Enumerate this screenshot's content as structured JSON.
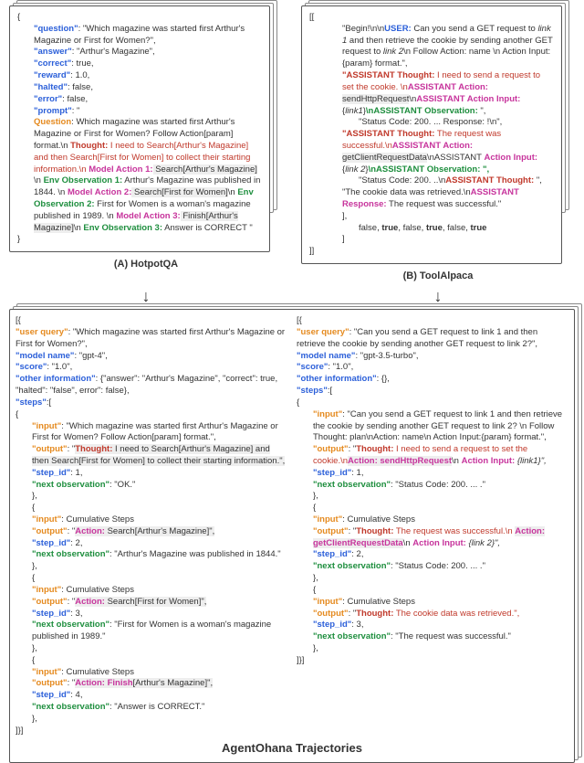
{
  "labels": {
    "a": "(A) HotpotQA",
    "b": "(B) ToolAlpaca",
    "bottom": "AgentOhana Trajectories",
    "arrow": "↓"
  },
  "boxA": {
    "open": "{",
    "q_key": "\"question\"",
    "q_val": ": \"Which magazine was started first Arthur's Magazine or First for Women?\",",
    "ans_key": "\"answer\"",
    "ans_val": ": \"Arthur's Magazine\",",
    "correct_key": "\"correct\"",
    "correct_val": ": true,",
    "reward_key": "\"reward\"",
    "reward_val": ": 1.0,",
    "halted_key": "\"halted\"",
    "halted_val": ": false,",
    "error_key": "\"error\"",
    "error_val": ": false,",
    "prompt_key": "\"prompt\"",
    "prompt_val": ": \"",
    "question_lbl": "Question",
    "question_txt": ": Which magazine was started first Arthur's Magazine or First for Women? Follow Action[param] format.\\n ",
    "thought_lbl": "Thought:",
    "thought_txt": " I need to Search[Arthur's Magazine] and then Search[First for Women] to collect their starting information.\\n ",
    "ma1_lbl": "Model Action 1:",
    "ma1_txt": " Search",
    "ma1_param": "[Arthur's Magazine]",
    "ma1_tail": " \\n ",
    "eo1_lbl": "Env Observation 1:",
    "eo1_txt": " Arthur's Magazine was published in 1844. \\n",
    "ma2_lbl": "Model Action 2:",
    "ma2_txt": " Search",
    "ma2_param": "[First for Women]",
    "ma2_tail": "\\n ",
    "eo2_lbl": "Env Observation 2:",
    "eo2_txt": " First for Women is a woman's magazine published in 1989. \\n ",
    "ma3_lbl": "Model Action 3:",
    "ma3_txt": " Finish",
    "ma3_param": "[Arthur's Magazine]",
    "ma3_tail": "\\n ",
    "eo3_lbl": "Env Observation 3:",
    "eo3_txt": " Answer is CORRECT \"",
    "close": "}"
  },
  "boxB": {
    "open": "[[",
    "begin": "\"Begin!\\n\\n",
    "user_lbl": "USER:",
    "user_txt": " Can you send a GET request to ",
    "link1": "link 1",
    "user_txt2": " and then retrieve the cookie by sending another GET request to ",
    "link2": "link 2",
    "user_txt3": "\\n Follow Action: name \\n Action Input:{param} format.\",",
    "at1_lbl": "\"ASSISTANT Thought:",
    "at1_txt": " I need to send a request to set the cookie. \\n",
    "aa_lbl": "ASSISTANT Action:",
    "aa_txt": " sendHttpRequest",
    "aa_tail": "\\n",
    "aai_lbl": "ASSISTANT Action Input:",
    "aai_txt": " {",
    "aai_link": "link1",
    "aai_tail": "}",
    "obs_lbl": "\\nASSISTANT Observation:",
    "obs_tail": " \",",
    "status1": "\"Status Code: 200. ... Response: !\\n\",",
    "at2_lbl": "\"ASSISTANT Thought:",
    "at2_txt": " The request was successful.\\n",
    "aa2_lbl": "ASSISTANT Action:",
    "aa2_txt": " getClientRequestData",
    "aa2_tail": "\\n",
    "aai2_lbl": "ASSISTANT ",
    "aai2_lbl2": "Action Input:",
    "aai2_txt": " {",
    "aai2_link": "link 2",
    "aai2_tail": "}",
    "obs2_tail": "\\nASSISTANT Observation: \",",
    "status2": "\"Status Code: 200. ..\\n",
    "at3_lbl": "ASSISTANT Thought:",
    "at3_txt": " \",",
    "cookie": "\"The cookie data was retrieved.\\n",
    "resp_lbl": "ASSISTANT Response:",
    "resp_txt": " The request was successful.\"",
    "close_arr": "],",
    "bools": "false, true, false, true, false, true",
    "close2": "]",
    "close3": "]]"
  },
  "botL": {
    "open": "[{",
    "uq_key": "\"user query\"",
    "uq_val": ": \"Which magazine was started first Arthur's Magazine or First for Women?\",",
    "mn_key": "\"model name\"",
    "mn_val": ": \"gpt-4\",",
    "score_key": "\"score\"",
    "score_val": ": \"1.0\",",
    "oi_key": "\"other information\"",
    "oi_val": ": {\"answer\": \"Arthur's Magazine\", \"correct\": true, \"halted\": \"false\", error\": false},",
    "steps_key": "\"steps\"",
    "steps_val": ":[",
    "s_open": "{",
    "in_key": "\"input\"",
    "s1_in": ": \"Which magazine was started first Arthur's Magazine or First for Women? Follow Action[param] format.\",",
    "out_key": "\"output\"",
    "s1_out_pre": ": \"",
    "s1_thought_lbl": "Thought:",
    "s1_thought_txt": " I need to Search[Arthur's Magazine] and then Search[First for Women] to collect their starting information.\",",
    "sid_key": "\"step_id\"",
    "s1_id": ": 1,",
    "no_key": "\"next observation\"",
    "s1_no": ": \"OK.\"",
    "s_close": "},",
    "cum": ": Cumulative Steps",
    "s2_out_pre": ": \"",
    "s2_act_lbl": "Action:",
    "s2_act_txt": " Search",
    "s2_act_param": "[Arthur's Magazine]\",",
    "s2_id": ": 2,",
    "s2_no": ": \"Arthur's Magazine was published in 1844.\"",
    "s3_act_param": "[First for Women]\",",
    "s3_id": ": 3,",
    "s3_no": ": \"First for Women is a woman's magazine published in 1989.\"",
    "s4_act_lbl": "Action: Finish",
    "s4_act_param": "[Arthur's Magazine]\",",
    "s4_id": ": 4,",
    "s4_no": ": \"Answer is CORRECT.\"",
    "close_steps": "},",
    "close_arr": "]}]"
  },
  "botR": {
    "open": "[{",
    "uq_key": "\"user query\"",
    "uq_val": ": \"Can you send a GET request to link 1 and then retrieve the cookie by sending another GET request to link 2?\",",
    "mn_key": "\"model name\"",
    "mn_val": ": \"gpt-3.5-turbo\",",
    "score_key": "\"score\"",
    "score_val": ": \"1.0\",",
    "oi_key": "\"other information\"",
    "oi_val": ": {},",
    "steps_key": "\"steps\"",
    "steps_val": ":[",
    "s_open": "{",
    "in_key": "\"input\"",
    "s1_in": ": \"Can you send a GET request to link 1 and then retrieve the cookie by sending another GET request to link 2? \\n Follow Thought: plan\\nAction: name\\n Action Input:{param} format.\",",
    "out_key": "\"output\"",
    "s1_out_pre": ": \"",
    "s1_thought_lbl": "Thought:",
    "s1_thought_txt": " I need to send a request to set the cookie.\\n",
    "s1_act_lbl": "Action: sendHttpRequest",
    "s1_act_tail": "\\n ",
    "s1_ai_lbl": "Action Input: ",
    "s1_ai_txt": "{link1}\",",
    "sid_key": "\"step_id\"",
    "s1_id": ": 1,",
    "no_key": "\"next observation\"",
    "s1_no": ": \"Status Code: 200. ... .\"",
    "s_close": "},",
    "cum": ": Cumulative Steps",
    "s2_out_pre": ": \"",
    "s2_thought_lbl": "Thought:",
    "s2_thought_txt": " The request was successful.\\n ",
    "s2_act_lbl": "Action: getClientRequestData",
    "s2_act_tail": "\\n ",
    "s2_ai_lbl": "Action Input: ",
    "s2_ai_txt": "{link 2}\",",
    "s2_id": ": 2,",
    "s2_no": ": \"Status Code: 200. ... .\"",
    "s3_thought_lbl": "Thought:",
    "s3_thought_txt": " The cookie data was retrieved.\",",
    "s3_id": ": 3,",
    "s3_no": ": \"The request was successful.\"",
    "close_steps": "},",
    "close_arr": "]}]"
  }
}
